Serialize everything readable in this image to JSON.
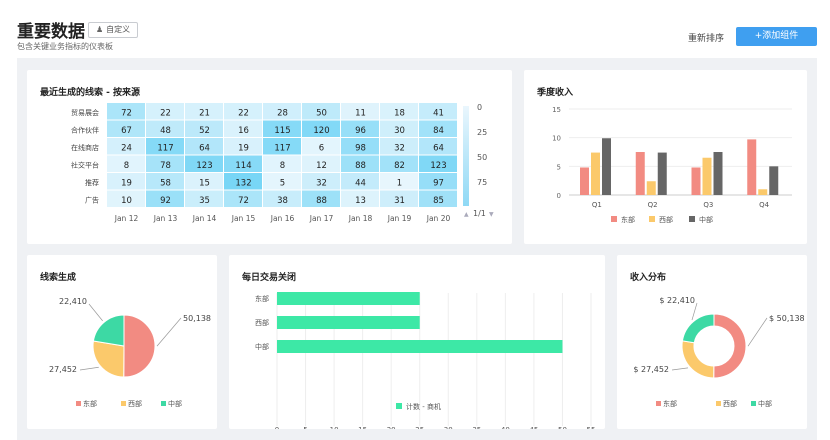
{
  "header": {
    "title": "重要数据",
    "custom_label": "自定义",
    "subtitle": "包含关键业务指标的仪表板",
    "reorder_label": "重新排序",
    "add_label": "+添加组件"
  },
  "colors": {
    "east": "#f28b82",
    "west": "#fbc96b",
    "central": "#3dd9a4",
    "gray": "#666666",
    "bar": "#3de8a6",
    "accent": "#3f9ff0"
  },
  "leads_heatmap": {
    "title": "最近生成的线索 - 按来源",
    "chart_data": {
      "type": "heatmap",
      "rows": [
        "贸易展会",
        "合作伙伴",
        "在线商店",
        "社交平台",
        "推荐",
        "广告"
      ],
      "columns": [
        "Jan 12",
        "Jan 13",
        "Jan 14",
        "Jan 15",
        "Jan 16",
        "Jan 17",
        "Jan 18",
        "Jan 19",
        "Jan 20"
      ],
      "values": [
        [
          72,
          22,
          21,
          22,
          28,
          50,
          11,
          18,
          41
        ],
        [
          67,
          48,
          52,
          16,
          115,
          120,
          96,
          30,
          84
        ],
        [
          24,
          117,
          64,
          19,
          117,
          6,
          98,
          32,
          64
        ],
        [
          8,
          78,
          123,
          114,
          8,
          12,
          88,
          82,
          123
        ],
        [
          19,
          58,
          15,
          132,
          5,
          32,
          44,
          1,
          97
        ],
        [
          10,
          92,
          35,
          72,
          38,
          88,
          13,
          31,
          85
        ]
      ],
      "scale_labels": [
        "0",
        "25",
        "50",
        "75"
      ],
      "pager": "1/1"
    }
  },
  "quarterly_revenue": {
    "title": "季度收入",
    "chart_data": {
      "type": "bar",
      "categories": [
        "Q1",
        "Q2",
        "Q3",
        "Q4"
      ],
      "series": [
        {
          "name": "东部",
          "values": [
            4.8,
            7.5,
            4.8,
            9.7
          ]
        },
        {
          "name": "西部",
          "values": [
            7.4,
            2.4,
            6.5,
            1.0
          ]
        },
        {
          "name": "中部",
          "values": [
            9.9,
            7.4,
            7.5,
            5.0
          ]
        }
      ],
      "ylim": [
        0,
        15
      ],
      "yticks": [
        0,
        5,
        10,
        15
      ]
    }
  },
  "leads_generated": {
    "title": "线索生成",
    "chart_data": {
      "type": "pie",
      "labels": [
        "东部",
        "西部",
        "中部"
      ],
      "values": [
        50138,
        27452,
        22410
      ],
      "value_labels": [
        "50,138",
        "27,452",
        "22,410"
      ]
    }
  },
  "daily_deals": {
    "title": "每日交易关闭",
    "chart_data": {
      "type": "bar",
      "orientation": "horizontal",
      "categories": [
        "东部",
        "西部",
        "中部"
      ],
      "values": [
        25,
        25,
        50
      ],
      "xlim": [
        0,
        55
      ],
      "xticks": [
        0,
        5,
        10,
        15,
        20,
        25,
        30,
        35,
        40,
        45,
        50,
        55
      ],
      "legend": "计数 - 商机"
    }
  },
  "revenue_distribution": {
    "title": "收入分布",
    "chart_data": {
      "type": "pie",
      "donut": true,
      "labels": [
        "东部",
        "西部",
        "中部"
      ],
      "values": [
        50138,
        27452,
        22410
      ],
      "value_labels": [
        "$ 50,138",
        "$ 27,452",
        "$ 22,410"
      ]
    }
  }
}
